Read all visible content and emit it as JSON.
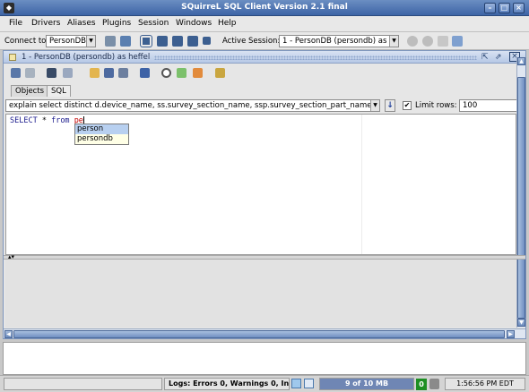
{
  "window": {
    "title": "SQuirreL SQL Client Version 2.1 final"
  },
  "menu": [
    "File",
    "Drivers",
    "Aliases",
    "Plugins",
    "Session",
    "Windows",
    "Help"
  ],
  "session_bar": {
    "connect_label": "Connect to:",
    "connect_value": "PersonDB",
    "active_label": "Active Session:",
    "active_value": "1 - PersonDB (persondb) as ..."
  },
  "internal_frame": {
    "title": "1 - PersonDB (persondb) as heffel"
  },
  "tabs": [
    "Objects",
    "SQL"
  ],
  "sql_bar": {
    "history_value": "explain select distinct d.device_name, ss.survey_section_name, ssp.survey_section_part_name, u...",
    "limit_label": "Limit rows:",
    "limit_value": "100",
    "limit_checked": "✔"
  },
  "editor": {
    "keyword1": "SELECT",
    "middle": " * ",
    "keyword2": "from",
    "space": " ",
    "partial": "pe"
  },
  "completion": [
    "person",
    "persondb"
  ],
  "status": {
    "logs": "Logs: Errors 0, Warnings 0, Infos 10",
    "memory": "9 of 10 MB",
    "gc": "0",
    "time": "1:56:56 PM EDT"
  },
  "colors": {
    "title_bar": "#3d64a6",
    "accent": "#6f8fc2",
    "error_text": "#c00000"
  }
}
